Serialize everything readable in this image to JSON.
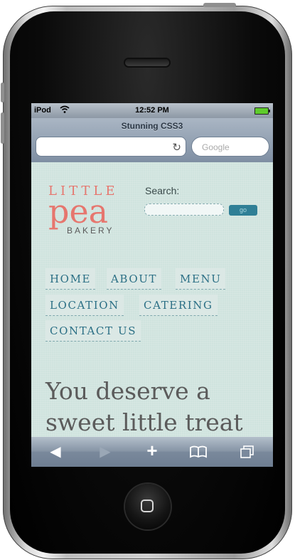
{
  "status_bar": {
    "carrier": "iPod",
    "time": "12:52 PM"
  },
  "browser": {
    "page_title": "Stunning CSS3",
    "search_placeholder": "Google"
  },
  "site": {
    "logo": {
      "line1": "LITTLE",
      "line2": "pea",
      "line3": "BAKERY"
    },
    "search_label": "Search:",
    "go_label": "go",
    "nav": [
      "HOME",
      "ABOUT",
      "MENU",
      "LOCATION",
      "CATERING",
      "CONTACT US"
    ],
    "hero_line1": "You deserve a",
    "hero_line2": "sweet little treat"
  },
  "colors": {
    "logo": "#e6766e",
    "nav_text": "#2b6f85",
    "page_bg": "#cfe3de",
    "go_button": "#2f7f96"
  },
  "icons": {
    "toolbar": [
      "back-arrow-icon",
      "forward-arrow-icon",
      "add-plus-icon",
      "bookmarks-book-icon",
      "pages-icon"
    ]
  }
}
